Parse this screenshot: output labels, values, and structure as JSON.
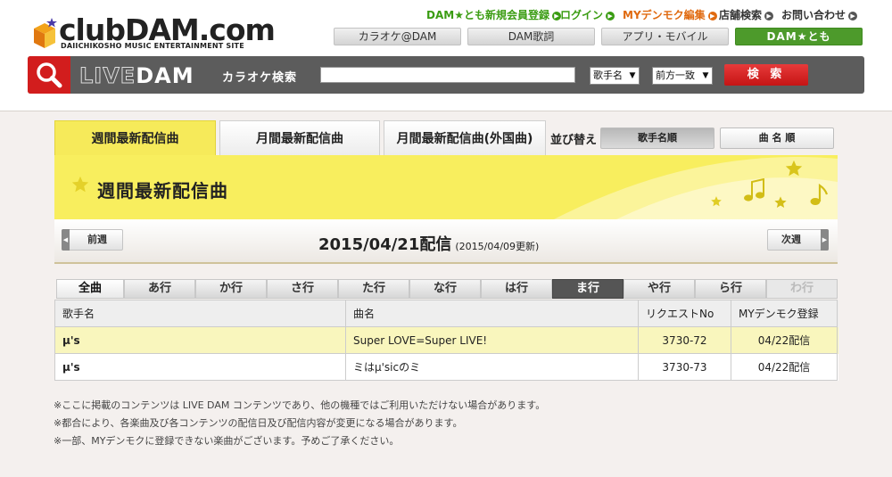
{
  "header": {
    "logo_text": "clubDAM.com",
    "logo_sub": "DAIICHIKOSHO MUSIC ENTERTAINMENT SITE",
    "top_links": [
      {
        "label": "DAM★とも新規会員登録"
      },
      {
        "label": "ログイン"
      },
      {
        "label": "MYデンモク編集"
      },
      {
        "label": "店舗検索"
      },
      {
        "label": "お問い合わせ"
      }
    ],
    "nav_tabs": [
      {
        "label": "カラオケ@DAM"
      },
      {
        "label": "DAM歌詞"
      },
      {
        "label": "アプリ・モバイル"
      },
      {
        "label": "DAM★とも"
      }
    ]
  },
  "search": {
    "brand_live": "LIVE",
    "brand_dam": "DAM",
    "label": "カラオケ検索",
    "query": "",
    "type_select": "歌手名",
    "match_select": "前方一致",
    "button": "検 索"
  },
  "page_tabs": [
    {
      "label": "週間最新配信曲"
    },
    {
      "label": "月間最新配信曲"
    },
    {
      "label": "月間最新配信曲(外国曲)"
    }
  ],
  "sort": {
    "label": "並び替え",
    "options": [
      {
        "label": "歌手名順"
      },
      {
        "label": "曲 名 順"
      }
    ]
  },
  "banner": {
    "title": "週間最新配信曲"
  },
  "date_bar": {
    "prev": "前週",
    "next": "次週",
    "main": "2015/04/21配信",
    "sub": "(2015/04/09更新)"
  },
  "kana_tabs": [
    "全曲",
    "あ行",
    "か行",
    "さ行",
    "た行",
    "な行",
    "は行",
    "ま行",
    "や行",
    "ら行",
    "わ行"
  ],
  "table": {
    "headers": [
      "歌手名",
      "曲名",
      "リクエストNo",
      "MYデンモク登録"
    ],
    "rows": [
      {
        "artist": "μ's",
        "song": "Super LOVE=Super LIVE!",
        "request_no": "3730-72",
        "my_denmoku": "04/22配信"
      },
      {
        "artist": "μ's",
        "song": "ミはμ'sicのミ",
        "request_no": "3730-73",
        "my_denmoku": "04/22配信"
      }
    ]
  },
  "notes": [
    "※ここに掲載のコンテンツは LIVE DAM コンテンツであり、他の機種ではご利用いただけない場合があります。",
    "※都合により、各楽曲及び各コンテンツの配信日及び配信内容が変更になる場合があります。",
    "※一部、MYデンモクに登録できない楽曲がございます。予めご了承ください。"
  ],
  "colors": {
    "accent_red": "#d21d1d",
    "green": "#4d9a2b",
    "banner_yellow": "#f8ee5e",
    "row_highlight": "#f9f6bd"
  }
}
